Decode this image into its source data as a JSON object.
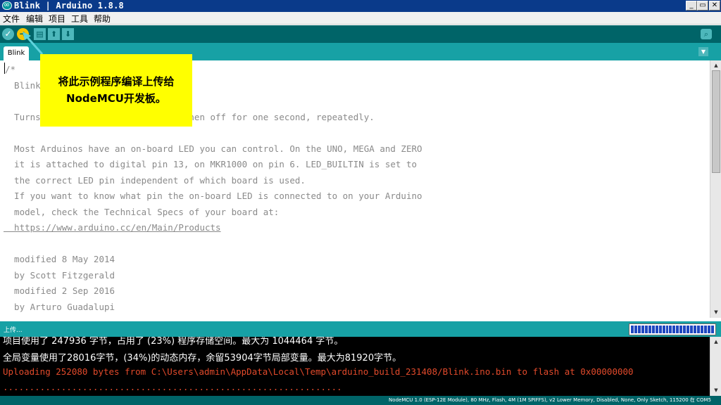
{
  "window": {
    "title": "Blink | Arduino 1.8.8",
    "minimize_label": "_",
    "maximize_label": "▭",
    "close_label": "✕"
  },
  "menu": [
    "文件",
    "编辑",
    "项目",
    "工具",
    "帮助"
  ],
  "toolbar": {
    "verify_icon": "check-icon",
    "upload_icon": "arrow-right-icon",
    "new_icon": "new-file-icon",
    "open_icon": "arrow-up-icon",
    "save_icon": "arrow-down-icon",
    "serial_monitor_icon": "magnifier-icon"
  },
  "tabs": [
    "Blink"
  ],
  "editor": {
    "lines": [
      "/*",
      "  Blink",
      "",
      "  Turns an LED on for one second, then off for one second, repeatedly.",
      "",
      "  Most Arduinos have an on-board LED you can control. On the UNO, MEGA and ZERO",
      "  it is attached to digital pin 13, on MKR1000 on pin 6. LED_BUILTIN is set to",
      "  the correct LED pin independent of which board is used.",
      "  If you want to know what pin the on-board LED is connected to on your Arduino",
      "  model, check the Technical Specs of your board at:",
      "  https://www.arduino.cc/en/Main/Products",
      "",
      "  modified 8 May 2014",
      "  by Scott Fitzgerald",
      "  modified 2 Sep 2016",
      "  by Arturo Guadalupi"
    ]
  },
  "callout": {
    "line1": "将此示例程序编译上传给",
    "line2": "NodeMCU开发板。"
  },
  "status": {
    "text": "上传...",
    "progress": 1.0
  },
  "console": {
    "lines": [
      "项目使用了 247936 字节，占用了 (23%) 程序存储空间。最大为 1044464 字节。",
      "全局变量使用了28016字节，(34%)的动态内存，余留53904字节局部变量。最大为81920字节。",
      "Uploading 252080 bytes from C:\\Users\\admin\\AppData\\Local\\Temp\\arduino_build_231408/Blink.ino.bin to flash at 0x00000000",
      "................................................................"
    ]
  },
  "bottom": {
    "board_info": "NodeMCU 1.0 (ESP-12E Module), 80 MHz, Flash, 4M (1M SPIFFS), v2 Lower Memory, Disabled, None, Only Sketch, 115200 在 COM5"
  },
  "colors": {
    "toolbar": "#006468",
    "tabstrip": "#17a1a5",
    "upload_active": "#f5c400",
    "callout": "#ffff00",
    "error_text": "#e24a2b",
    "progress_fill": "#2048c0"
  }
}
